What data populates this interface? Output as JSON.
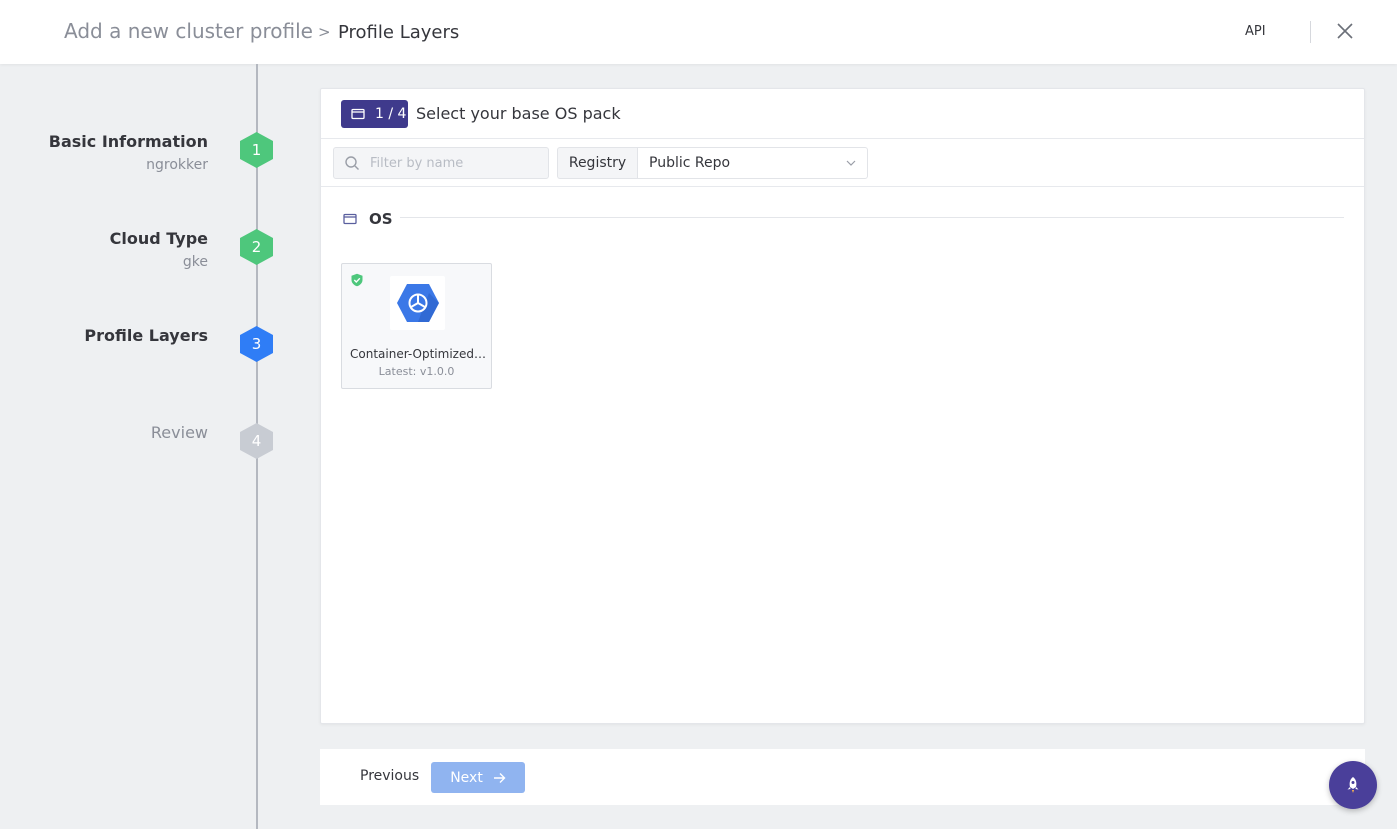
{
  "header": {
    "breadcrumb_root": "Add a new cluster profile",
    "breadcrumb_separator": ">",
    "breadcrumb_current": "Profile Layers",
    "api_label": "API",
    "close_icon": "close-icon"
  },
  "steps": [
    {
      "title": "Basic Information",
      "subtitle": "ngrokker",
      "number": "1",
      "state": "done"
    },
    {
      "title": "Cloud Type",
      "subtitle": "gke",
      "number": "2",
      "state": "done"
    },
    {
      "title": "Profile Layers",
      "subtitle": "",
      "number": "3",
      "state": "active"
    },
    {
      "title": "Review",
      "subtitle": "",
      "number": "4",
      "state": "pending"
    }
  ],
  "panel": {
    "step_badge": "1 / 4",
    "title": "Select your base OS pack",
    "search_placeholder": "Filter by name",
    "registry_label": "Registry",
    "registry_value": "Public Repo",
    "section_label": "OS",
    "packs": [
      {
        "name": "Container-Optimized OS",
        "version": "Latest: v1.0.0",
        "verified": true,
        "icon": "gcp-container-os-icon"
      }
    ]
  },
  "footer": {
    "previous_label": "Previous",
    "next_label": "Next"
  },
  "colors": {
    "brand_purple": "#3f3a8c",
    "step_done": "#4ec77c",
    "step_active": "#2f7df6",
    "step_pending": "#c8ccd3",
    "next_disabled": "#90b4f0"
  }
}
